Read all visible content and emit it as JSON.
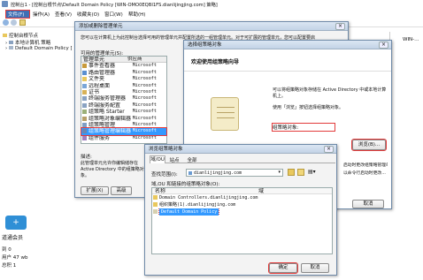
{
  "main_window": {
    "title": "控制台1 - [控制台根节点\\Default Domain Policy [WIN-OMO0EQBI1FS.dianlijingjing.com] 策略]",
    "menu": [
      "文件(F)",
      "操作(A)",
      "查看(V)",
      "收藏夹(O)",
      "窗口(W)",
      "帮助(H)"
    ],
    "right_stub": "WIN-…"
  },
  "left_tree": {
    "items": [
      "控制台根节点",
      "本地计算机 策略",
      "Default Domain Policy ["
    ]
  },
  "bottom_left": {
    "title": "道通会员",
    "lines": [
      "到 0",
      "用户 47 wb",
      "总积 1"
    ],
    "logo_text": "+"
  },
  "addsnap_dialog": {
    "title": "添加或删除管理单元",
    "desc": "您可以在计算机上为此控制台选择可用的管理单元并配置所选的一组管理单元。对于可扩展的管理单元，您可以配置要启",
    "available_label": "可用的管理单元(S):",
    "columns": [
      "管理单元",
      "供应商"
    ],
    "rows": [
      {
        "name": "事件查看器",
        "vendor": "Microsoft"
      },
      {
        "name": "路由管理器",
        "vendor": "Microsoft"
      },
      {
        "name": "文件夹",
        "vendor": "Microsoft"
      },
      {
        "name": "远程桌面",
        "vendor": "Microsoft"
      },
      {
        "name": "证书",
        "vendor": "Microsoft"
      },
      {
        "name": "终端服务管理器",
        "vendor": "Microsoft"
      },
      {
        "name": "终端服务配置",
        "vendor": "Microsoft"
      },
      {
        "name": "组策略 Starter",
        "vendor": "Microsoft"
      },
      {
        "name": "组策略对象编辑器",
        "vendor": "Microsoft"
      },
      {
        "name": "组策略管理",
        "vendor": "Microsoft"
      },
      {
        "name": "组策略管理编辑器",
        "vendor": "Microsoft"
      },
      {
        "name": "组件服务",
        "vendor": "Microsoft"
      }
    ],
    "selected_index": 10,
    "desc_label": "描述:",
    "desc_text": "此管理单元允许你编辑储存在 Active Directory 中的组策略对象。",
    "expand_button": "扩展(X)",
    "advanced_button": "高级"
  },
  "wizard_dialog": {
    "title": "选择组策略对象",
    "heading": "欢迎使用组策略向导",
    "p1": "可以将组策略对象存储在 Active Directory 中或本地计算机上。",
    "p2": "使用「浏览」按钮选择组策略对象。",
    "gpo_label": "组策略对象:",
    "browse_button": "浏览(B)...",
    "note1": "启动时更改组策略管理单元",
    "note2": "以命令行启动时更改…",
    "cancel_button": "取消"
  },
  "browse_dialog": {
    "title": "浏览组策略对象",
    "tabs": [
      "域/OU",
      "站点",
      "全部"
    ],
    "lookin_label": "查找范围(I):",
    "lookin_value": "dianlijingjing.com",
    "list_label": "域,OU 和链接的组策略对象(O):",
    "columns": [
      "名称",
      "域"
    ],
    "rows": [
      {
        "name": "Domain Controllers.dianlijingjing.com"
      },
      {
        "name": "组织策略(1).dianlijingjing.com"
      },
      {
        "name": "Default Domain Policy"
      }
    ],
    "selected_index": 2,
    "ok_button": "确定",
    "cancel_button": "取消"
  },
  "colors": {
    "highlight": "#e23b3b",
    "selection": "#3399ff",
    "title_gradient": "#c3d3e6"
  },
  "icons": [
    "folder-icon",
    "gpo-scroll-icon",
    "add-folder-icon",
    "dropdown-arrow-icon"
  ]
}
